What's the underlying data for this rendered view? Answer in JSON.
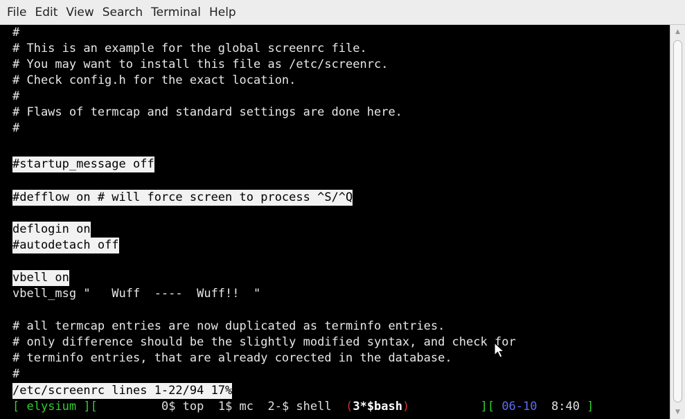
{
  "menubar": {
    "items": [
      "File",
      "Edit",
      "View",
      "Search",
      "Terminal",
      "Help"
    ]
  },
  "terminal": {
    "lines": [
      "#",
      "# This is an example for the global screenrc file.",
      "# You may want to install this file as /etc/screenrc.",
      "# Check config.h for the exact location.",
      "#",
      "# Flaws of termcap and standard settings are done here.",
      "#",
      "",
      "#startup_message off",
      "",
      "#defflow on # will force screen to process ^S/^Q",
      "",
      "deflogin on",
      "#autodetach off",
      "",
      "vbell on",
      "vbell_msg \"   Wuff  ----  Wuff!!  \"",
      "",
      "# all termcap entries are now duplicated as terminfo entries.",
      "# only difference should be the slightly modified syntax, and check for",
      "# terminfo entries, that are already corected in the database.",
      "#"
    ],
    "pager_status": "/etc/screenrc lines 1-22/94 17%"
  },
  "hardstatus": {
    "open": "[ ",
    "host": "elysium",
    "sep1": " ][",
    "windows": "         0$ top  1$ mc  2-$ shell  ",
    "active_open": "(",
    "active": "3*$bash",
    "active_close": ")",
    "sep2": "          ][ ",
    "date": "06-10",
    "gap": "  ",
    "time": "8:40",
    "close": " ]"
  },
  "scrollbar": {
    "up_icon": "arrow-up",
    "down_icon": "arrow-down"
  },
  "colors": {
    "hardstatus_green": "#2fcf2f",
    "hardstatus_red": "#d03030",
    "hardstatus_blue": "#5d6df0",
    "highlight_bg": "#f2f2f2"
  }
}
